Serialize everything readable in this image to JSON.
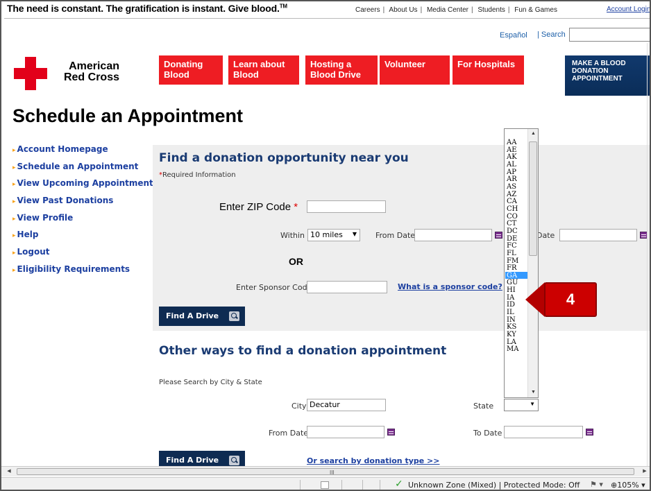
{
  "header": {
    "tagline": "The need is constant. The gratification is instant. Give blood.",
    "tagline_tm": "TM",
    "util_links": [
      "Careers",
      "About Us",
      "Media Center",
      "Students",
      "Fun & Games"
    ],
    "account_login": "Account Login",
    "language": "Español",
    "search_label": "| Search"
  },
  "brand": {
    "line1": "American",
    "line2": "Red Cross"
  },
  "nav": [
    {
      "l1": "Donating",
      "l2": "Blood"
    },
    {
      "l1": "Learn about",
      "l2": "Blood"
    },
    {
      "l1": "Hosting a",
      "l2": "Blood Drive"
    },
    {
      "l1": "Volunteer",
      "l2": ""
    },
    {
      "l1": "For Hospitals",
      "l2": ""
    }
  ],
  "make_appt": {
    "l1": "MAKE A BLOOD",
    "l2": "DONATION",
    "l3": "APPOINTMENT"
  },
  "page_title": "Schedule an Appointment",
  "sidebar": [
    "Account Homepage",
    "Schedule an Appointment",
    "View Upcoming Appointments",
    "View Past Donations",
    "View Profile",
    "Help",
    "Logout",
    "Eligibility Requirements"
  ],
  "find_panel": {
    "title": "Find a donation opportunity near you",
    "required": "Required Information",
    "zip_label": "Enter ZIP Code",
    "zip_value": "",
    "within_label": "Within",
    "within_value": "10 miles",
    "from_date_label": "From Date",
    "to_date_label": "Date",
    "or_label": "OR",
    "sponsor_label": "Enter Sponsor Code",
    "sponsor_link": "What is a sponsor code?",
    "button": "Find A Drive"
  },
  "other_ways": {
    "title": "Other ways to find a donation appointment",
    "subtitle": "Please Search by City & State",
    "city_label": "City",
    "city_value": "Decatur",
    "state_label": "State",
    "from_date_label": "From Date",
    "to_date_label": "To Date",
    "button": "Find A Drive",
    "donation_type_link": "Or search by donation type >>"
  },
  "state_dropdown": {
    "options": [
      "AA",
      "AE",
      "AK",
      "AL",
      "AP",
      "AR",
      "AS",
      "AZ",
      "CA",
      "CH",
      "CO",
      "CT",
      "DC",
      "DE",
      "FC",
      "FL",
      "FM",
      "FR",
      "GA",
      "GU",
      "HI",
      "IA",
      "ID",
      "IL",
      "IN",
      "KS",
      "KY",
      "LA",
      "MA"
    ],
    "selected": "GA"
  },
  "callout": {
    "number": "4",
    "color": "#cc0000"
  },
  "statusbar": {
    "zone": "Unknown Zone (Mixed) | Protected Mode: Off",
    "zoom": "105%"
  },
  "colors": {
    "red": "#ee1d23",
    "navy": "#0e2b52",
    "link": "#1c3fa0",
    "heading": "#1a3b73",
    "selection": "#3399ff"
  }
}
